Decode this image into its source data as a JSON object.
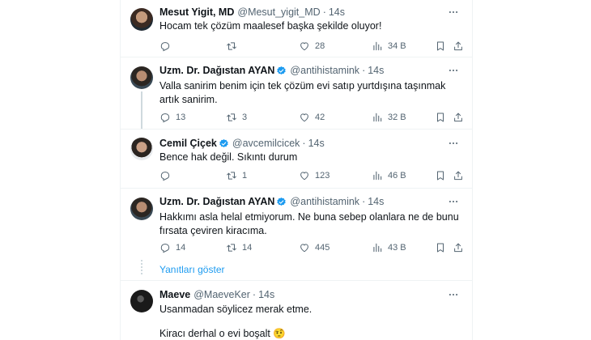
{
  "tweets": [
    {
      "name": "Mesut Yigit, MD",
      "handle": "@Mesut_yigit_MD",
      "time": "14s",
      "verified": false,
      "text": "Hocam tek çözüm maalesef başka şekilde oluyor!",
      "replies": "",
      "retweets": "",
      "likes": "28",
      "views": "34 B"
    },
    {
      "name": "Uzm. Dr. Dağıstan AYAN",
      "handle": "@antihistamink",
      "time": "14s",
      "verified": true,
      "text": "Valla sanirim benim için tek çözüm evi satıp yurtdışına taşınmak artık sanirim.",
      "replies": "13",
      "retweets": "3",
      "likes": "42",
      "views": "32 B"
    },
    {
      "name": "Cemil Çiçek",
      "handle": "@avcemilcicek",
      "time": "14s",
      "verified": true,
      "text": "Bence hak değil. Sıkıntı durum",
      "replies": "",
      "retweets": "1",
      "likes": "123",
      "views": "46 B"
    },
    {
      "name": "Uzm. Dr. Dağıstan AYAN",
      "handle": "@antihistamink",
      "time": "14s",
      "verified": true,
      "text": "Hakkımı asla helal etmiyorum. Ne buna sebep olanlara ne de bunu fırsata çeviren kiracıma.",
      "replies": "14",
      "retweets": "14",
      "likes": "445",
      "views": "43 B"
    },
    {
      "name": "Maeve",
      "handle": "@MaeveKer",
      "time": "14s",
      "verified": false,
      "text": "Usanmadan söylicez merak etme.",
      "text2": "Kiracı derhal o evi boşalt",
      "emoji": "🤨"
    }
  ],
  "show_replies": "Yanıtları göster",
  "colors": {
    "accent": "#1d9bf0",
    "secondary_text": "#536471",
    "divider": "#eff3f4"
  },
  "icons": [
    "reply-icon",
    "retweet-icon",
    "like-icon",
    "views-icon",
    "bookmark-icon",
    "share-icon",
    "more-icon",
    "verified-badge-icon"
  ]
}
